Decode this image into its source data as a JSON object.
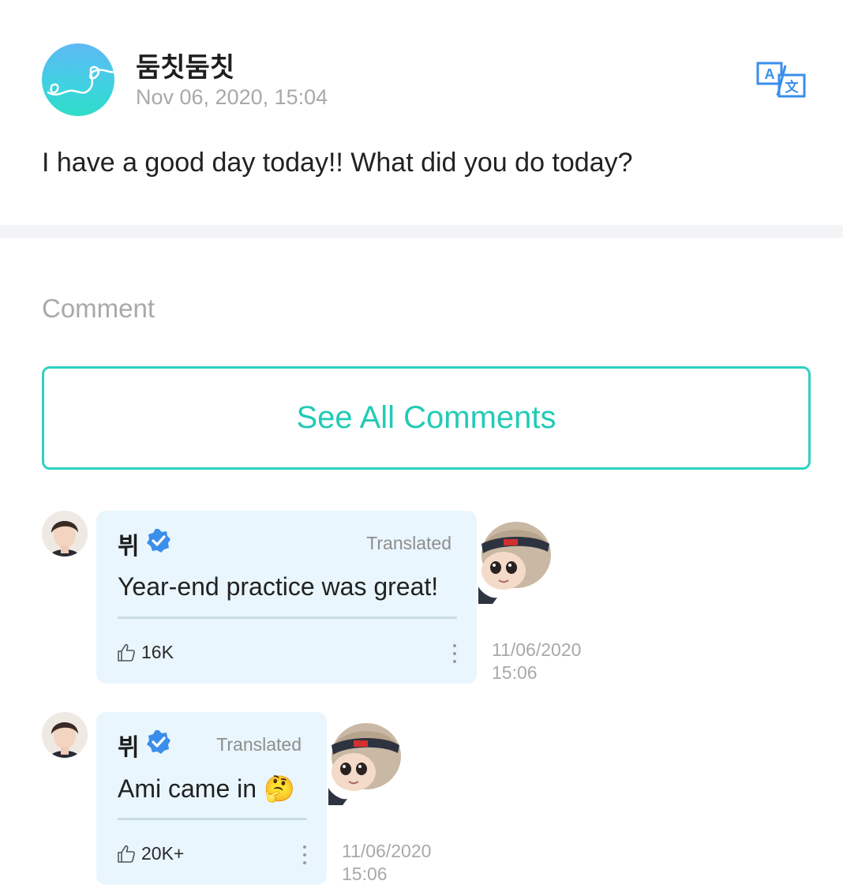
{
  "post": {
    "author": "둠칫둠칫",
    "date": "Nov 06, 2020, 15:04",
    "body": "I have a good day today!! What did you do today?"
  },
  "comments_section": {
    "heading": "Comment",
    "see_all_label": "See All Comments"
  },
  "comments": [
    {
      "author": "뷔",
      "verified": true,
      "translated_label": "Translated",
      "text": "Year-end practice was great!",
      "likes": "16K",
      "date": "11/06/2020",
      "time": "15:06"
    },
    {
      "author": "뷔",
      "verified": true,
      "translated_label": "Translated",
      "text": "Ami came in",
      "emoji": "🤔",
      "likes": "20K+",
      "date": "11/06/2020",
      "time": "15:06"
    }
  ],
  "colors": {
    "accent": "#22cbb6",
    "bubble": "#e9f6fd",
    "verified": "#3b8eea",
    "translate_icon": "#3b8eea"
  },
  "icons": [
    "translate-icon",
    "verified-badge-icon",
    "thumbs-up-icon",
    "more-options-icon"
  ]
}
